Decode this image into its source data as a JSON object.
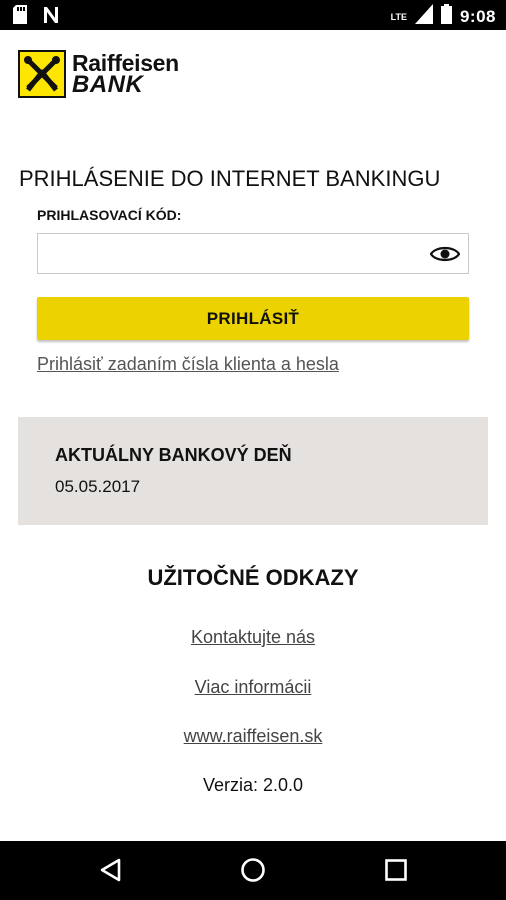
{
  "status_bar": {
    "time": "9:08",
    "network": "LTE",
    "icons": [
      "sd-card-icon",
      "n-notification-icon",
      "signal-icon",
      "battery-icon"
    ]
  },
  "logo": {
    "line1": "Raiffeisen",
    "line2": "BANK"
  },
  "login": {
    "title": "PRIHLÁSENIE DO INTERNET BANKINGU",
    "code_label": "PRIHLASOVACÍ KÓD:",
    "code_value": "",
    "button_label": "PRIHLÁSIŤ",
    "alt_link": "Prihlásiť zadaním čísla klienta a hesla"
  },
  "bank_day": {
    "title": "AKTUÁLNY BANKOVÝ DEŇ",
    "date": "05.05.2017"
  },
  "useful_links": {
    "heading": "UŽITOČNÉ ODKAZY",
    "contact": "Kontaktujte nás",
    "more_info": "Viac informácii",
    "website": "www.raiffeisen.sk"
  },
  "version": "Verzia: 2.0.0",
  "colors": {
    "brand_yellow": "#ffe600",
    "button_yellow": "#ecd200",
    "card_bg": "#e5e1de"
  }
}
